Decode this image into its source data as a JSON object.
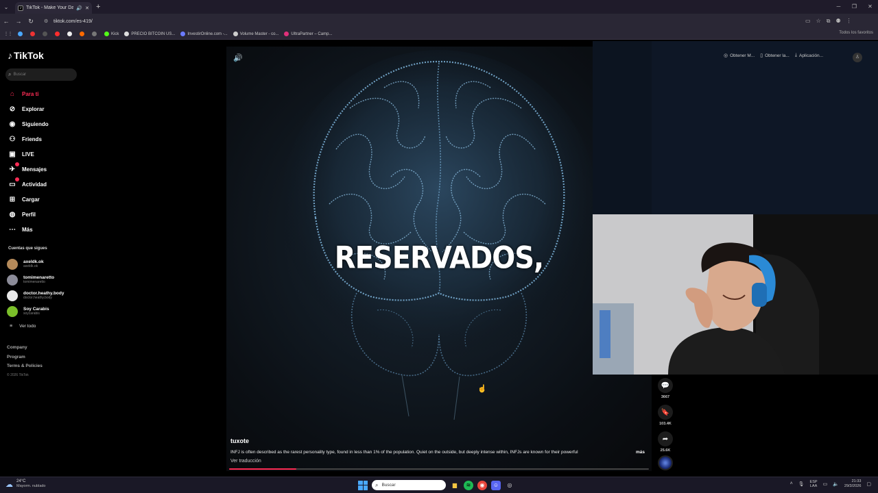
{
  "browser": {
    "tab_title": "TikTok - Make Your Day",
    "url": "tiktok.com/es-419/",
    "bookmarks": [
      {
        "label": "",
        "color": "#4aa8ff"
      },
      {
        "label": "",
        "color": "#e33"
      },
      {
        "label": "",
        "color": "#555"
      },
      {
        "label": "",
        "color": "#ff2d2d"
      },
      {
        "label": "",
        "color": "#eee"
      },
      {
        "label": "",
        "color": "#ff6a00"
      },
      {
        "label": "",
        "color": "#777"
      },
      {
        "label": "Kick",
        "color": "#53fc18"
      },
      {
        "label": "PRECIO BITCOIN US...",
        "color": "#ddd"
      },
      {
        "label": "InvestirOnline.com -...",
        "color": "#6b7bff"
      },
      {
        "label": "Volume Master - co...",
        "color": "#ccc"
      },
      {
        "label": "UltraPartner – Camp...",
        "color": "#e0307a"
      }
    ],
    "all_bookmarks": "Todos los favoritos"
  },
  "sidebar": {
    "logo": "TikTok",
    "search_placeholder": "Buscar",
    "menu": [
      {
        "label": "Para ti",
        "icon": "home-icon",
        "glyph": "⌂",
        "active": true,
        "badge": false
      },
      {
        "label": "Explorar",
        "icon": "compass-icon",
        "glyph": "⊘",
        "active": false,
        "badge": false
      },
      {
        "label": "Siguiendo",
        "icon": "following-icon",
        "glyph": "◉",
        "active": false,
        "badge": false
      },
      {
        "label": "Friends",
        "icon": "friends-icon",
        "glyph": "⚇",
        "active": false,
        "badge": false
      },
      {
        "label": "LIVE",
        "icon": "live-icon",
        "glyph": "▣",
        "active": false,
        "badge": false
      },
      {
        "label": "Mensajes",
        "icon": "messages-icon",
        "glyph": "✈",
        "active": false,
        "badge": true
      },
      {
        "label": "Actividad",
        "icon": "activity-icon",
        "glyph": "▭",
        "active": false,
        "badge": true
      },
      {
        "label": "Cargar",
        "icon": "upload-icon",
        "glyph": "⊞",
        "active": false,
        "badge": false
      },
      {
        "label": "Perfil",
        "icon": "profile-icon",
        "glyph": "◍",
        "active": false,
        "badge": false
      },
      {
        "label": "Más",
        "icon": "more-icon",
        "glyph": "⋯",
        "active": false,
        "badge": false
      }
    ],
    "following_title": "Cuentas que sigues",
    "following": [
      {
        "name": "axeldk.ok",
        "handle": "axeldk.ok",
        "color": "#b58a5a"
      },
      {
        "name": "tomimenaretto",
        "handle": "tomimenaretto",
        "color": "#8c8c99"
      },
      {
        "name": "doctor.heathy.body",
        "handle": "doctor.heathy.body",
        "color": "#e8e8e8"
      },
      {
        "name": "Soy Carabis",
        "handle": "soycarabis",
        "color": "#7bbf2a"
      }
    ],
    "see_all": "Ver todo",
    "footer": [
      "Company",
      "Program",
      "Terms & Policies"
    ],
    "copyright": "© 2026 TikTok"
  },
  "video": {
    "caption_overlay": "RESERVADOS,",
    "author": "tuxote",
    "description": "INFJ is often described as the rarest personality type, found in less than 1% of the population. Quiet on the outside, but deeply intense within, INFJs are known for their powerful",
    "more": "más",
    "translate": "Ver traducción",
    "progress": 0.16
  },
  "actions": [
    {
      "icon": "comment-icon",
      "glyph": "💬",
      "count": "3667"
    },
    {
      "icon": "bookmark-icon",
      "glyph": "🔖",
      "count": "103.4K"
    },
    {
      "icon": "share-icon",
      "glyph": "➦",
      "count": "25.6K"
    }
  ],
  "top_actions": [
    {
      "icon": "coin-icon",
      "label": "Obtener M..."
    },
    {
      "icon": "phone-icon",
      "label": "Obtener la..."
    },
    {
      "icon": "download-icon",
      "label": "Aplicación..."
    }
  ],
  "taskbar": {
    "temp": "24°C",
    "condition": "Mayorm. nublado",
    "search": "Buscar",
    "lang_top": "ESP",
    "lang_bottom": "LAA",
    "time": "21:33",
    "date": "29/3/2026"
  }
}
